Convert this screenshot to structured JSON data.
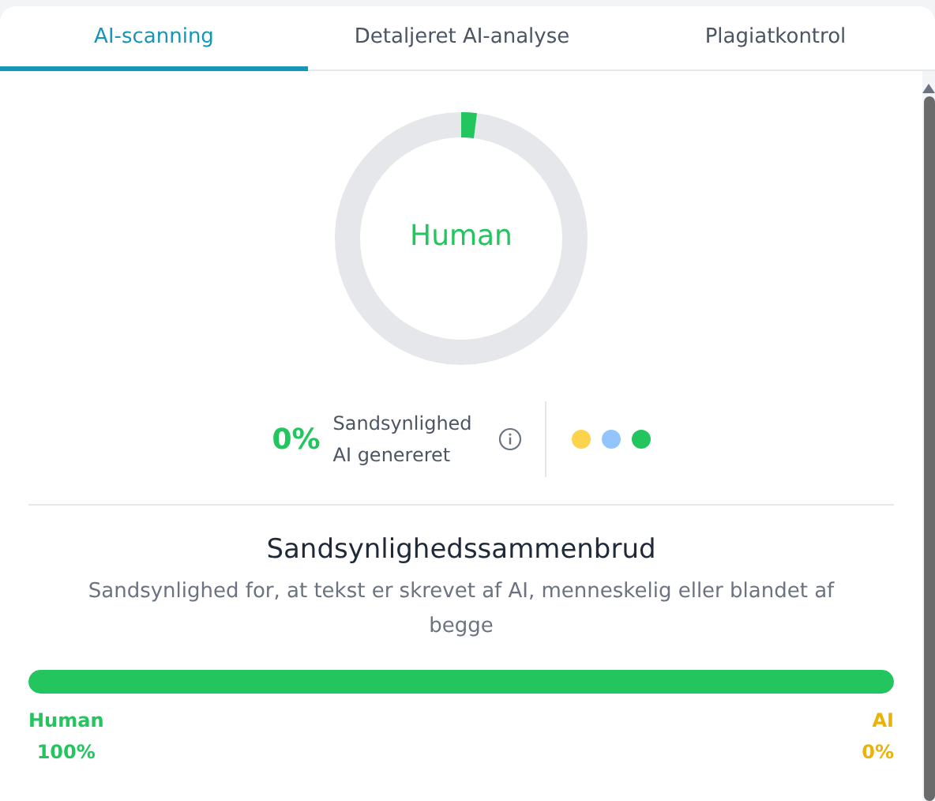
{
  "tabs": [
    {
      "label": "AI-scanning",
      "selected": true
    },
    {
      "label": "Detaljeret AI-analyse",
      "selected": false
    },
    {
      "label": "Plagiatkontrol",
      "selected": false
    }
  ],
  "gauge": {
    "label": "Human"
  },
  "probability": {
    "value": "0%",
    "label_line_1": "Sandsynlighed",
    "label_line_2": "AI genereret"
  },
  "legend_dots": [
    {
      "color": "#fcd34d"
    },
    {
      "color": "#93c5fd"
    },
    {
      "color": "#22c55e"
    }
  ],
  "breakdown": {
    "title": "Sandsynlighedssammenbrud",
    "subtitle": "Sandsynlighed for, at tekst er skrevet af AI, menneskelig eller blandet af begge",
    "level": 1,
    "left": {
      "label": "Human",
      "value": "100%"
    },
    "right": {
      "label": "AI",
      "value": "0%"
    }
  }
}
